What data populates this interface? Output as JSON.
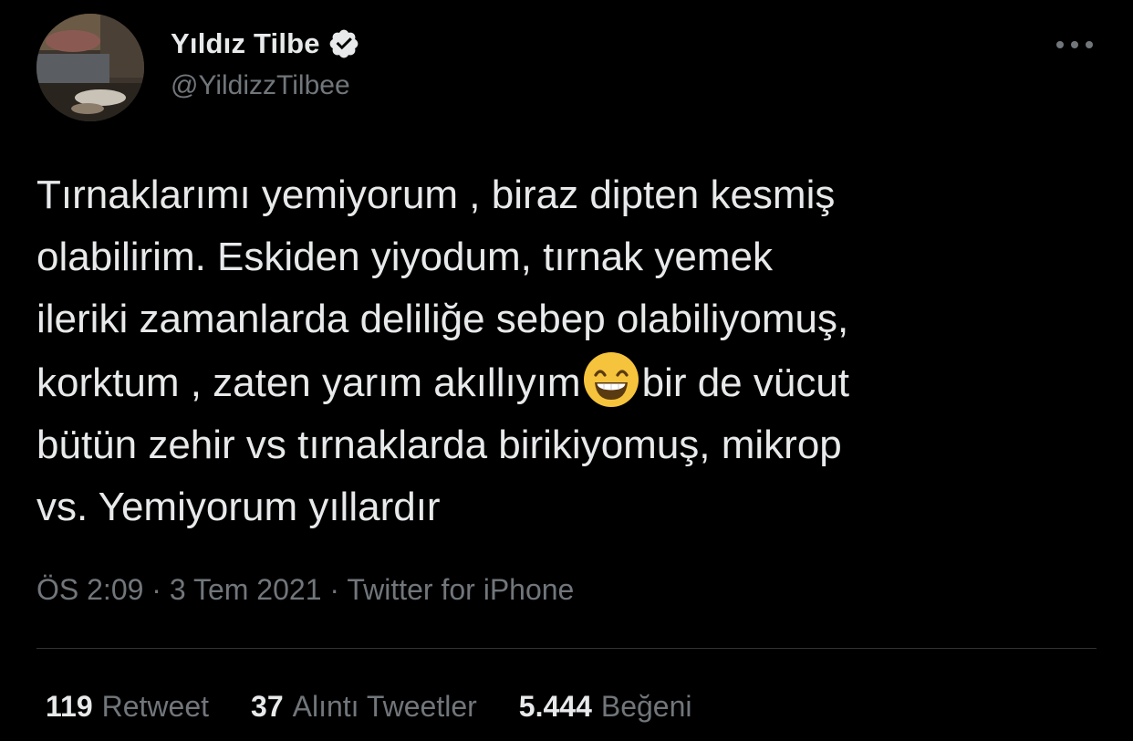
{
  "author": {
    "display_name": "Yıldız Tilbe",
    "handle": "@YildizzTilbee",
    "verified_icon": "verified-badge-icon",
    "avatar": "profile-photo"
  },
  "menu": {
    "icon": "more-options-icon"
  },
  "tweet": {
    "lines": [
      "Tırnaklarımı yemiyorum , biraz dipten kesmiş",
      "olabilirim. Eskiden yiyodum, tırnak yemek",
      "ileriki zamanlarda deliliğe sebep olabiliyomuş,",
      "korktum , zaten yarım akıllıyım",
      "bir de vücut",
      "bütün zehir vs tırnaklarda birikiyomuş, mikrop",
      "vs. Yemiyorum yıllardır"
    ],
    "emoji": "grinning-face-with-smiling-eyes"
  },
  "meta": {
    "time": "ÖS 2:09",
    "separator": "·",
    "date": "3 Tem 2021",
    "source": "Twitter for iPhone"
  },
  "stats": {
    "retweets_count": "119",
    "retweets_label": "Retweet",
    "quotes_count": "37",
    "quotes_label": "Alıntı Tweetler",
    "likes_count": "5.444",
    "likes_label": "Beğeni"
  },
  "colors": {
    "background": "#000000",
    "primary_text": "#e7e9ea",
    "secondary_text": "#71767b",
    "divider": "#2f3336",
    "emoji": "#f6c33c"
  }
}
